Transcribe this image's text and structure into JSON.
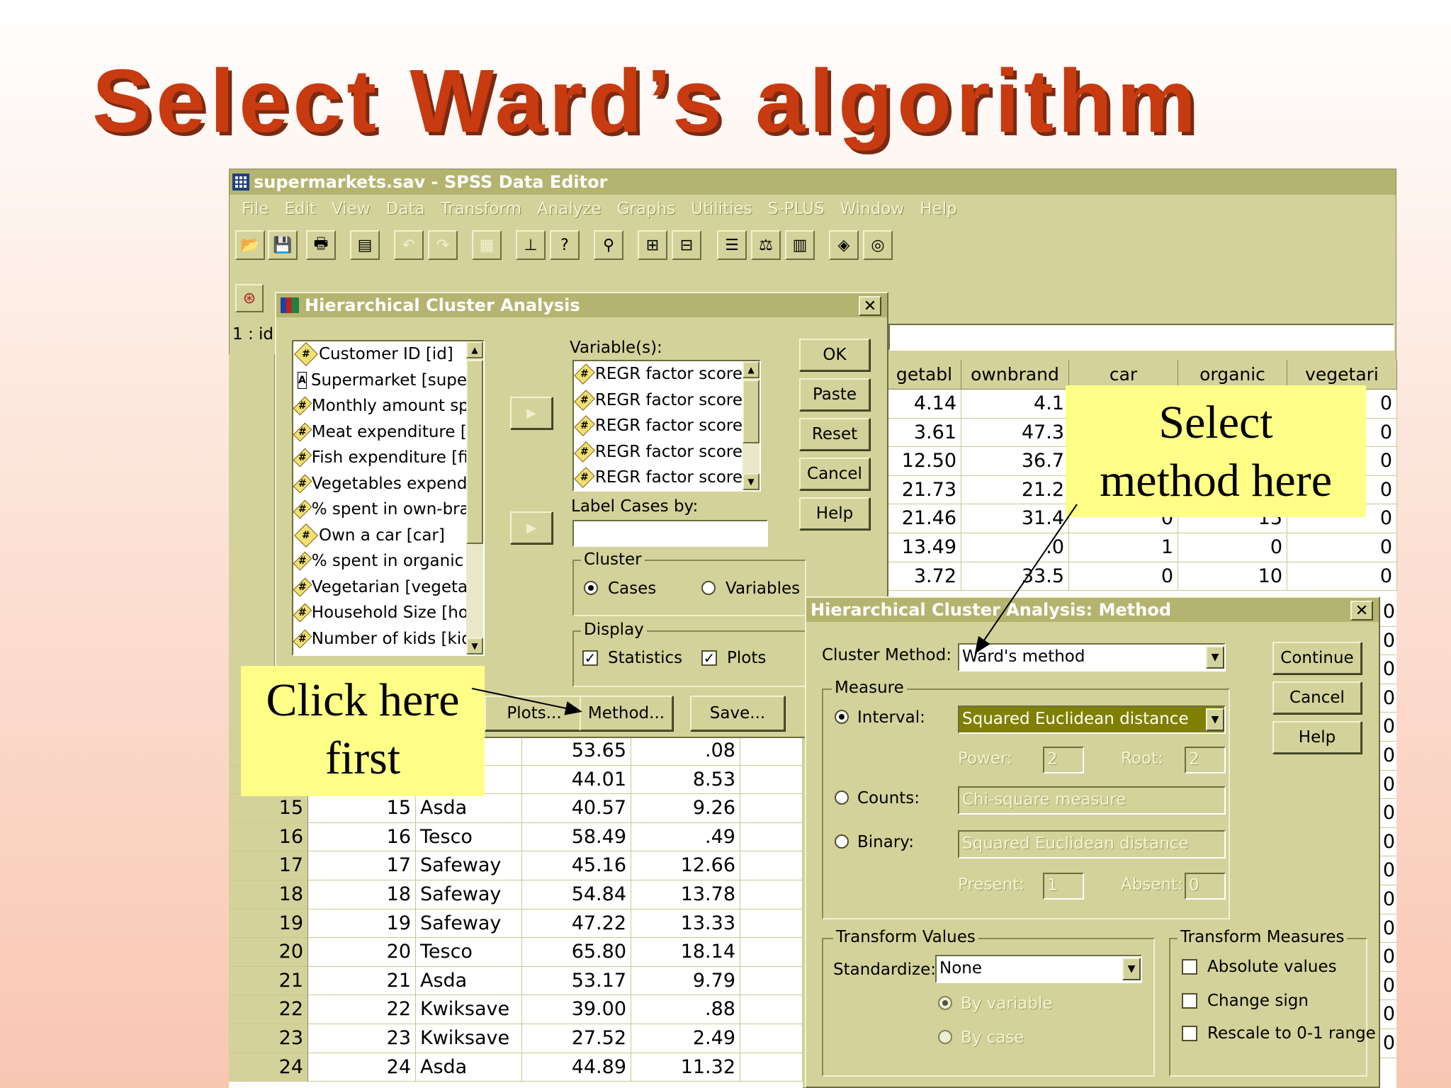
{
  "slide": {
    "title": "Select  Ward’s  algorithm"
  },
  "app": {
    "window_title": "supermarkets.sav - SPSS Data Editor",
    "menu": [
      "File",
      "Edit",
      "View",
      "Data",
      "Transform",
      "Analyze",
      "Graphs",
      "Utilities",
      "S-PLUS",
      "Window",
      "Help"
    ],
    "cell_ref": "1 : id"
  },
  "grid": {
    "headers": [
      "getabl",
      "ownbrand",
      "car",
      "organic",
      "vegetari"
    ],
    "top_rows": [
      [
        "4.14",
        "4.1",
        "",
        "",
        "0"
      ],
      [
        "3.61",
        "47.3",
        "",
        "",
        "0"
      ],
      [
        "12.50",
        "36.7",
        "",
        "",
        "0"
      ],
      [
        "21.73",
        "21.2",
        "",
        "",
        "0"
      ],
      [
        "21.46",
        "31.4",
        "0",
        "15",
        "0"
      ],
      [
        "13.49",
        ".0",
        "1",
        "0",
        "0"
      ],
      [
        "3.72",
        "33.5",
        "0",
        "10",
        "0"
      ]
    ],
    "bottom_rows": [
      [
        "",
        "",
        "",
        "53.65",
        ".08"
      ],
      [
        "",
        "",
        "",
        "44.01",
        "8.53"
      ],
      [
        "15",
        "15",
        "Asda",
        "40.57",
        "9.26"
      ],
      [
        "16",
        "16",
        "Tesco",
        "58.49",
        ".49"
      ],
      [
        "17",
        "17",
        "Safeway",
        "45.16",
        "12.66"
      ],
      [
        "18",
        "18",
        "Safeway",
        "54.84",
        "13.78"
      ],
      [
        "19",
        "19",
        "Safeway",
        "47.22",
        "13.33"
      ],
      [
        "20",
        "20",
        "Tesco",
        "65.80",
        "18.14"
      ],
      [
        "21",
        "21",
        "Asda",
        "53.17",
        "9.79"
      ],
      [
        "22",
        "22",
        "Kwiksave",
        "39.00",
        ".88"
      ],
      [
        "23",
        "23",
        "Kwiksave",
        "27.52",
        "2.49"
      ],
      [
        "24",
        "24",
        "Asda",
        "44.89",
        "11.32"
      ]
    ],
    "right_edge_values": [
      "0",
      "0",
      "0",
      "0",
      "0",
      "0",
      "0",
      "0",
      "0",
      "0",
      "0",
      "0",
      "0",
      "0",
      "0",
      "0"
    ]
  },
  "hca_dialog": {
    "title": "Hierarchical Cluster Analysis",
    "source_list": [
      {
        "icon": "#",
        "label": "Customer ID [id]"
      },
      {
        "icon": "A",
        "label": "Supermarket [supern"
      },
      {
        "icon": "#",
        "label": "Monthly amount sper"
      },
      {
        "icon": "#",
        "label": "Meat expenditure [m"
      },
      {
        "icon": "#",
        "label": "Fish expenditure [fish"
      },
      {
        "icon": "#",
        "label": "Vegetables expendit"
      },
      {
        "icon": "#",
        "label": "% spent in own-bran"
      },
      {
        "icon": "#",
        "label": "Own a car [car]"
      },
      {
        "icon": "#",
        "label": "% spent in organic fo"
      },
      {
        "icon": "#",
        "label": "Vegetarian [vegetari]"
      },
      {
        "icon": "#",
        "label": "Household Size [hou"
      },
      {
        "icon": "#",
        "label": "Number of kids [kids"
      }
    ],
    "variables_label": "Variable(s):",
    "variables": [
      "REGR factor score",
      "REGR factor score",
      "REGR factor score",
      "REGR factor score",
      "REGR factor score"
    ],
    "label_cases_label": "Label Cases by:",
    "cluster_group": "Cluster",
    "cluster_cases": "Cases",
    "cluster_variables": "Variables",
    "display_group": "Display",
    "display_statistics": "Statistics",
    "display_plots": "Plots",
    "buttons": {
      "ok": "OK",
      "paste": "Paste",
      "reset": "Reset",
      "cancel": "Cancel",
      "help": "Help",
      "plots": "Plots...",
      "method": "Method...",
      "save": "Save..."
    }
  },
  "method_dialog": {
    "title": "Hierarchical Cluster Analysis: Method",
    "cluster_method_label": "Cluster Method:",
    "cluster_method_value": "Ward's method",
    "measure_group": "Measure",
    "interval_label": "Interval:",
    "interval_value": "Squared Euclidean distance",
    "power_label": "Power:",
    "power_value": "2",
    "root_label": "Root:",
    "root_value": "2",
    "counts_label": "Counts:",
    "counts_value": "Chi-square measure",
    "binary_label": "Binary:",
    "binary_value": "Squared Euclidean distance",
    "present_label": "Present:",
    "present_value": "1",
    "absent_label": "Absent:",
    "absent_value": "0",
    "transform_values_group": "Transform Values",
    "standardize_label": "Standardize:",
    "standardize_value": "None",
    "by_variable": "By variable",
    "by_case": "By case",
    "transform_measures_group": "Transform Measures",
    "absolute_values": "Absolute values",
    "change_sign": "Change sign",
    "rescale": "Rescale to 0-1 range",
    "buttons": {
      "continue": "Continue",
      "cancel": "Cancel",
      "help": "Help"
    }
  },
  "callouts": {
    "method_line1": "Select",
    "method_line2": "method here",
    "first_line1": "Click here",
    "first_line2": "first"
  },
  "colors": {
    "title_red": "#c83a10",
    "ui_face": "#d2d29a",
    "titlebar": "#b4b470",
    "callout_yellow": "#ffff88",
    "selection": "#808000"
  }
}
